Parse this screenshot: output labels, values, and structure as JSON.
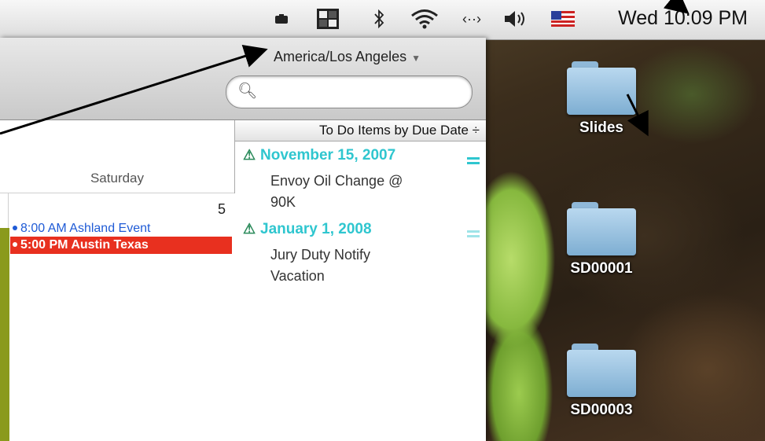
{
  "menubar": {
    "icons": [
      "camera-icon",
      "grid-icon",
      "bluetooth-icon",
      "wifi-icon",
      "sync-arrows-icon",
      "volume-icon",
      "us-flag-icon"
    ],
    "clock": "Wed 10:09 PM"
  },
  "calendar": {
    "timezone": "America/Los Angeles",
    "search_placeholder": "",
    "day_name": "Saturday",
    "day_number": "5",
    "events": [
      {
        "time": "8:00 AM",
        "title": "Ashland Event",
        "color": "#1f5bd6",
        "selected": false
      },
      {
        "time": "5:00 PM",
        "title": "Austin Texas",
        "color": "#e8301f",
        "selected": true
      }
    ]
  },
  "todo": {
    "header": "To Do Items by Due Date ÷",
    "items": [
      {
        "date": "November 15, 2007",
        "lines": [
          "Envoy Oil Change @",
          "90K"
        ]
      },
      {
        "date": "January 1, 2008",
        "lines": [
          "Jury Duty Notify",
          "Vacation"
        ]
      }
    ]
  },
  "desktop": {
    "folders": [
      "Slides",
      "SD00001",
      "SD00003"
    ]
  }
}
